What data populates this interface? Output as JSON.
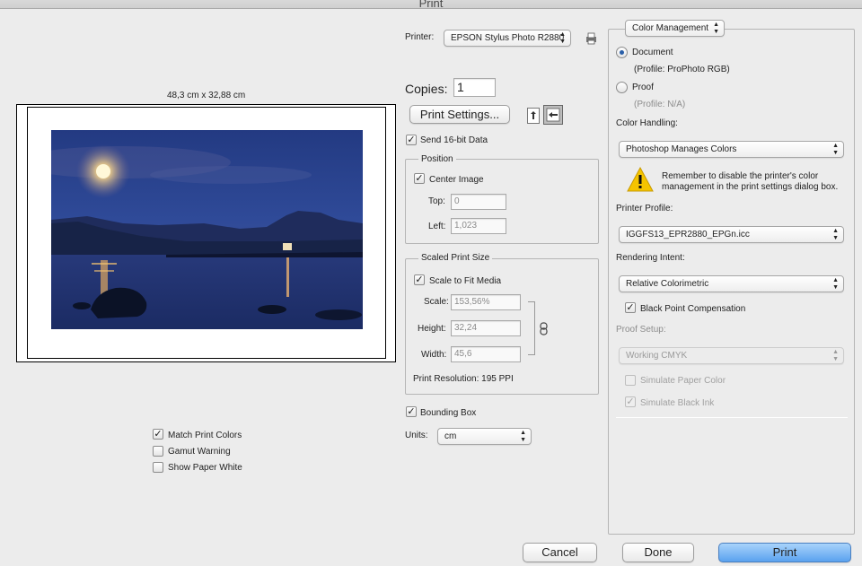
{
  "window": {
    "title": "Print"
  },
  "preview": {
    "dimensions": "48,3 cm x 32,88 cm",
    "match_print_colors": "Match Print Colors",
    "gamut_warning": "Gamut Warning",
    "show_paper_white": "Show Paper White"
  },
  "printer": {
    "label": "Printer:",
    "value": "EPSON Stylus Photo R2880",
    "copies_label": "Copies:",
    "copies_value": "1",
    "print_settings_label": "Print Settings...",
    "send_16bit_label": "Send 16-bit Data"
  },
  "position": {
    "title": "Position",
    "center_image_label": "Center Image",
    "top_label": "Top:",
    "top_value": "0",
    "left_label": "Left:",
    "left_value": "1,023"
  },
  "scaled": {
    "title": "Scaled Print Size",
    "scale_to_fit_label": "Scale to Fit Media",
    "scale_label": "Scale:",
    "scale_value": "153,56%",
    "height_label": "Height:",
    "height_value": "32,24",
    "width_label": "Width:",
    "width_value": "45,6",
    "resolution_text": "Print Resolution: 195 PPI"
  },
  "bounding_box_label": "Bounding Box",
  "units": {
    "label": "Units:",
    "value": "cm"
  },
  "color": {
    "section_popup": "Color Management",
    "document_label": "Document",
    "document_profile": "(Profile: ProPhoto RGB)",
    "proof_label": "Proof",
    "proof_profile": "(Profile: N/A)",
    "handling_label": "Color Handling:",
    "handling_value": "Photoshop Manages Colors",
    "warning_text": "Remember to disable the printer's color management in the print settings dialog box.",
    "printer_profile_label": "Printer Profile:",
    "printer_profile_value": "IGGFS13_EPR2880_EPGn.icc",
    "rendering_label": "Rendering Intent:",
    "rendering_value": "Relative Colorimetric",
    "black_point_label": "Black Point Compensation",
    "proof_setup_label": "Proof Setup:",
    "proof_setup_value": "Working CMYK",
    "simulate_paper_label": "Simulate Paper Color",
    "simulate_black_label": "Simulate Black Ink"
  },
  "buttons": {
    "cancel": "Cancel",
    "done": "Done",
    "print": "Print"
  },
  "colors": {
    "accent": "#5aa2ef",
    "warning": "#f5c400"
  }
}
